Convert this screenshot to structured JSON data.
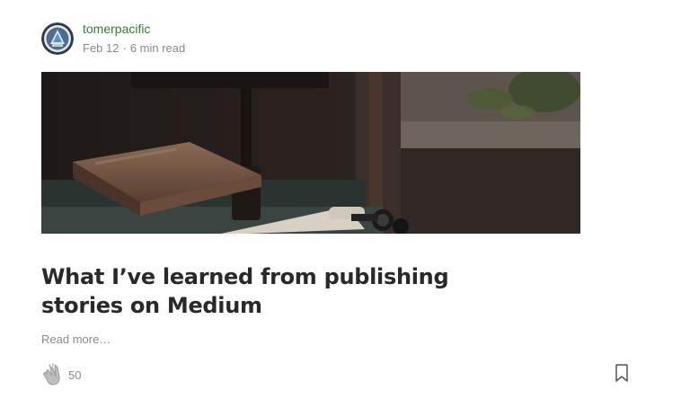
{
  "author": {
    "name": "tomerpacific",
    "avatar_icon": "avatar-logo-icon"
  },
  "post": {
    "date": "Feb 12",
    "separator": "·",
    "read_time": "6 min read",
    "title": "What I’ve learned from publishing stories on Medium",
    "read_more": "Read more…"
  },
  "actions": {
    "clap_icon": "clap-icon",
    "clap_count": "50",
    "bookmark_icon": "bookmark-icon"
  },
  "colors": {
    "author_link": "#3b7a3b",
    "meta_text": "#8a8a8a",
    "title_text": "#292929"
  }
}
